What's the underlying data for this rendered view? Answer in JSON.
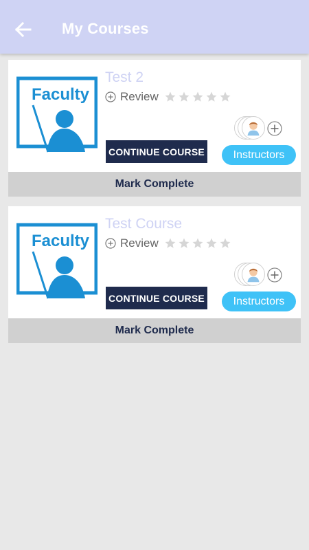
{
  "appbar": {
    "title": "My Courses",
    "back_icon": "arrow-left-icon",
    "background": "#cfd3f4"
  },
  "colors": {
    "course_title": "#cfd3f4",
    "continue_button": "#1f2b4d",
    "instructors_button": "#3fc2f7",
    "mark_complete_bg": "#d0d0d0",
    "logo_blue": "#1b8fd3"
  },
  "courses": [
    {
      "title": "Test 2",
      "logo_text": "Faculty",
      "review_label": "Review",
      "rating": 0,
      "rating_max": 5,
      "continue_label": "CONTINUE COURSE",
      "instructors_label": "Instructors",
      "mark_complete_label": "Mark Complete"
    },
    {
      "title": "Test Course",
      "logo_text": "Faculty",
      "review_label": "Review",
      "rating": 0,
      "rating_max": 5,
      "continue_label": "CONTINUE COURSE",
      "instructors_label": "Instructors",
      "mark_complete_label": "Mark Complete"
    }
  ]
}
